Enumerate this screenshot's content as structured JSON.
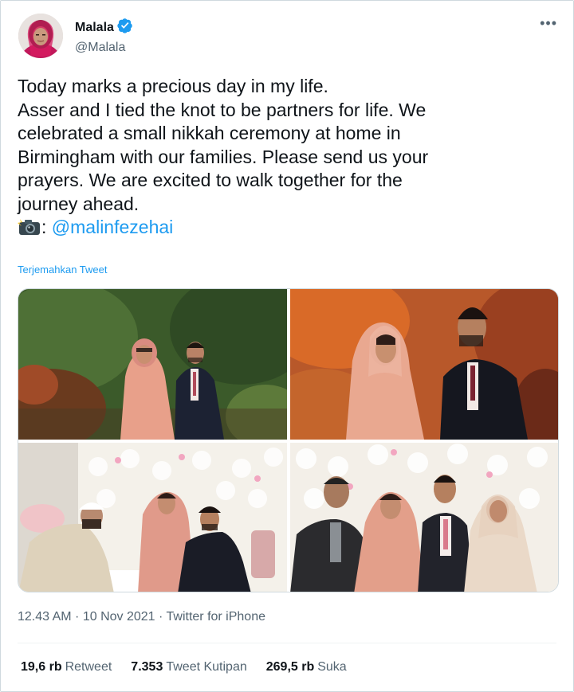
{
  "user": {
    "display_name": "Malala",
    "handle": "@Malala",
    "verified": true,
    "avatar_icon": "profile-photo",
    "more_icon": "more-horizontal-icon"
  },
  "tweet": {
    "lines": [
      "Today marks a precious day in my life.",
      "Asser and I tied the knot to be partners for life. We",
      "celebrated a small nikkah ceremony at home in",
      "Birmingham with our families. Please send us your",
      "prayers. We are excited to walk together for the",
      "journey ahead."
    ],
    "credit_emoji": "camera-flash-icon",
    "credit_separator": ":",
    "credit_mention": "@malinfezehai",
    "translate_label": "Terjemahkan Tweet"
  },
  "media": {
    "photos": [
      {
        "icon": "photo-garden-couple"
      },
      {
        "icon": "photo-autumn-couple"
      },
      {
        "icon": "photo-nikkah-signing"
      },
      {
        "icon": "photo-family-group"
      }
    ]
  },
  "meta": {
    "time": "12.43 AM",
    "sep1": " · ",
    "date": "10 Nov 2021",
    "sep2": " · ",
    "source": "Twitter for iPhone"
  },
  "stats": {
    "retweets_value": "19,6 rb",
    "retweets_label": "Retweet",
    "quotes_value": "7.353",
    "quotes_label": "Tweet Kutipan",
    "likes_value": "269,5 rb",
    "likes_label": "Suka"
  },
  "colors": {
    "accent": "#1d9bf0",
    "text": "#0f1419",
    "secondary": "#536471",
    "border": "#cfd9de"
  }
}
